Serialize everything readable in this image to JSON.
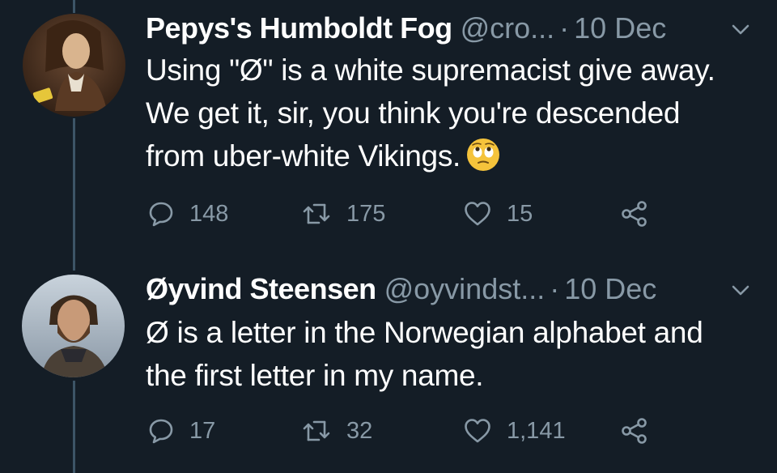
{
  "colors": {
    "background": "#141d26",
    "text_primary": "#ffffff",
    "text_secondary": "#8899a6",
    "thread_line": "#3d5466"
  },
  "tweets": [
    {
      "display_name": "Pepys's Humboldt Fog",
      "handle": "@cro...",
      "separator": "·",
      "date": "10 Dec",
      "text": "Using \"Ø\" is a white supremacist give away.  We get it, sir, you think you're descended from uber-white Vikings.",
      "emoji": "face-with-rolling-eyes",
      "replies": "148",
      "retweets": "175",
      "likes": "15",
      "icons": {
        "reply": "reply-icon",
        "retweet": "retweet-icon",
        "like": "heart-icon",
        "share": "share-icon",
        "menu": "chevron-down-icon"
      }
    },
    {
      "display_name": "Øyvind Steensen",
      "handle": "@oyvindst...",
      "separator": "·",
      "date": "10 Dec",
      "text": "Ø is a letter in the Norwegian alphabet and the first letter in my name.",
      "replies": "17",
      "retweets": "32",
      "likes": "1,141",
      "icons": {
        "reply": "reply-icon",
        "retweet": "retweet-icon",
        "like": "heart-icon",
        "share": "share-icon",
        "menu": "chevron-down-icon"
      }
    }
  ]
}
